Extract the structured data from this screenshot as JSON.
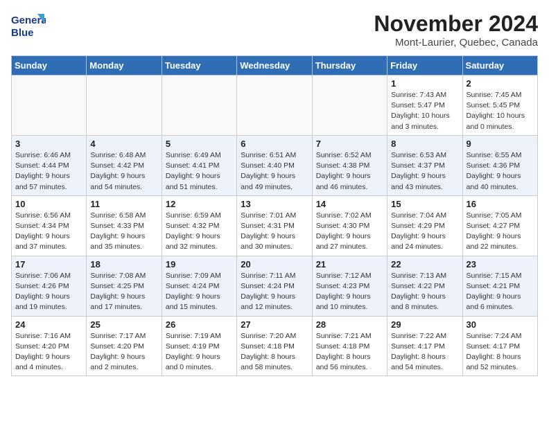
{
  "logo": {
    "line1": "General",
    "line2": "Blue"
  },
  "title": "November 2024",
  "location": "Mont-Laurier, Quebec, Canada",
  "weekdays": [
    "Sunday",
    "Monday",
    "Tuesday",
    "Wednesday",
    "Thursday",
    "Friday",
    "Saturday"
  ],
  "weeks": [
    [
      {
        "day": "",
        "info": ""
      },
      {
        "day": "",
        "info": ""
      },
      {
        "day": "",
        "info": ""
      },
      {
        "day": "",
        "info": ""
      },
      {
        "day": "",
        "info": ""
      },
      {
        "day": "1",
        "info": "Sunrise: 7:43 AM\nSunset: 5:47 PM\nDaylight: 10 hours\nand 3 minutes."
      },
      {
        "day": "2",
        "info": "Sunrise: 7:45 AM\nSunset: 5:45 PM\nDaylight: 10 hours\nand 0 minutes."
      }
    ],
    [
      {
        "day": "3",
        "info": "Sunrise: 6:46 AM\nSunset: 4:44 PM\nDaylight: 9 hours\nand 57 minutes."
      },
      {
        "day": "4",
        "info": "Sunrise: 6:48 AM\nSunset: 4:42 PM\nDaylight: 9 hours\nand 54 minutes."
      },
      {
        "day": "5",
        "info": "Sunrise: 6:49 AM\nSunset: 4:41 PM\nDaylight: 9 hours\nand 51 minutes."
      },
      {
        "day": "6",
        "info": "Sunrise: 6:51 AM\nSunset: 4:40 PM\nDaylight: 9 hours\nand 49 minutes."
      },
      {
        "day": "7",
        "info": "Sunrise: 6:52 AM\nSunset: 4:38 PM\nDaylight: 9 hours\nand 46 minutes."
      },
      {
        "day": "8",
        "info": "Sunrise: 6:53 AM\nSunset: 4:37 PM\nDaylight: 9 hours\nand 43 minutes."
      },
      {
        "day": "9",
        "info": "Sunrise: 6:55 AM\nSunset: 4:36 PM\nDaylight: 9 hours\nand 40 minutes."
      }
    ],
    [
      {
        "day": "10",
        "info": "Sunrise: 6:56 AM\nSunset: 4:34 PM\nDaylight: 9 hours\nand 37 minutes."
      },
      {
        "day": "11",
        "info": "Sunrise: 6:58 AM\nSunset: 4:33 PM\nDaylight: 9 hours\nand 35 minutes."
      },
      {
        "day": "12",
        "info": "Sunrise: 6:59 AM\nSunset: 4:32 PM\nDaylight: 9 hours\nand 32 minutes."
      },
      {
        "day": "13",
        "info": "Sunrise: 7:01 AM\nSunset: 4:31 PM\nDaylight: 9 hours\nand 30 minutes."
      },
      {
        "day": "14",
        "info": "Sunrise: 7:02 AM\nSunset: 4:30 PM\nDaylight: 9 hours\nand 27 minutes."
      },
      {
        "day": "15",
        "info": "Sunrise: 7:04 AM\nSunset: 4:29 PM\nDaylight: 9 hours\nand 24 minutes."
      },
      {
        "day": "16",
        "info": "Sunrise: 7:05 AM\nSunset: 4:27 PM\nDaylight: 9 hours\nand 22 minutes."
      }
    ],
    [
      {
        "day": "17",
        "info": "Sunrise: 7:06 AM\nSunset: 4:26 PM\nDaylight: 9 hours\nand 19 minutes."
      },
      {
        "day": "18",
        "info": "Sunrise: 7:08 AM\nSunset: 4:25 PM\nDaylight: 9 hours\nand 17 minutes."
      },
      {
        "day": "19",
        "info": "Sunrise: 7:09 AM\nSunset: 4:24 PM\nDaylight: 9 hours\nand 15 minutes."
      },
      {
        "day": "20",
        "info": "Sunrise: 7:11 AM\nSunset: 4:24 PM\nDaylight: 9 hours\nand 12 minutes."
      },
      {
        "day": "21",
        "info": "Sunrise: 7:12 AM\nSunset: 4:23 PM\nDaylight: 9 hours\nand 10 minutes."
      },
      {
        "day": "22",
        "info": "Sunrise: 7:13 AM\nSunset: 4:22 PM\nDaylight: 9 hours\nand 8 minutes."
      },
      {
        "day": "23",
        "info": "Sunrise: 7:15 AM\nSunset: 4:21 PM\nDaylight: 9 hours\nand 6 minutes."
      }
    ],
    [
      {
        "day": "24",
        "info": "Sunrise: 7:16 AM\nSunset: 4:20 PM\nDaylight: 9 hours\nand 4 minutes."
      },
      {
        "day": "25",
        "info": "Sunrise: 7:17 AM\nSunset: 4:20 PM\nDaylight: 9 hours\nand 2 minutes."
      },
      {
        "day": "26",
        "info": "Sunrise: 7:19 AM\nSunset: 4:19 PM\nDaylight: 9 hours\nand 0 minutes."
      },
      {
        "day": "27",
        "info": "Sunrise: 7:20 AM\nSunset: 4:18 PM\nDaylight: 8 hours\nand 58 minutes."
      },
      {
        "day": "28",
        "info": "Sunrise: 7:21 AM\nSunset: 4:18 PM\nDaylight: 8 hours\nand 56 minutes."
      },
      {
        "day": "29",
        "info": "Sunrise: 7:22 AM\nSunset: 4:17 PM\nDaylight: 8 hours\nand 54 minutes."
      },
      {
        "day": "30",
        "info": "Sunrise: 7:24 AM\nSunset: 4:17 PM\nDaylight: 8 hours\nand 52 minutes."
      }
    ]
  ]
}
